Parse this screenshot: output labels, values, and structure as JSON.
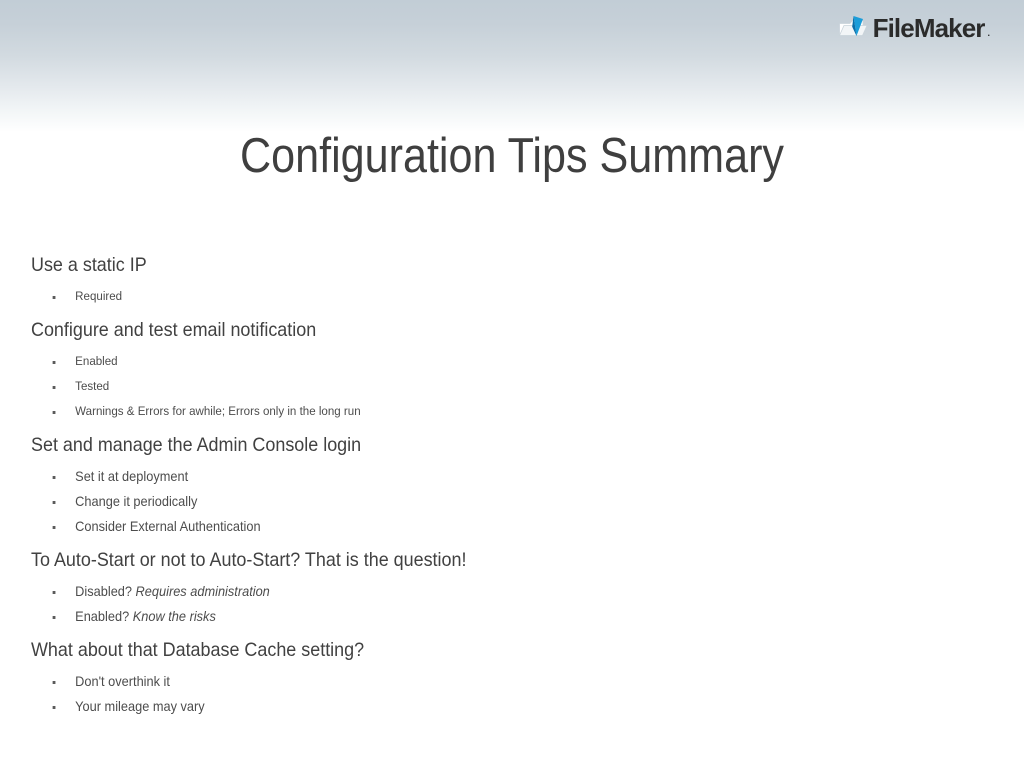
{
  "slide": {
    "title": "Configuration Tips Summary",
    "background_top_color": "#c2cdd6",
    "background_bottom_color": "#ffffff",
    "title_color": "#3f3f3f",
    "body_text_color": "#4c4c4c"
  },
  "brand": {
    "name": "FileMaker",
    "trademark": ".",
    "mark_icon": "filemaker-folder-icon",
    "mark_color": "#1b9dd9",
    "mark_color_dark": "#0a6ea8",
    "word_color": "#2b2b2b"
  },
  "sections": [
    {
      "heading": "Use a static IP",
      "bullets": [
        {
          "text": "Required",
          "emphasis": ""
        }
      ]
    },
    {
      "heading": "Configure and test email notification",
      "bullets": [
        {
          "text": "Enabled",
          "emphasis": ""
        },
        {
          "text": "Tested",
          "emphasis": ""
        },
        {
          "text": "Warnings & Errors for awhile; Errors only in the long run",
          "emphasis": ""
        }
      ]
    },
    {
      "heading": "Set and manage the Admin Console login",
      "bullets": [
        {
          "text": "Set it at deployment",
          "emphasis": ""
        },
        {
          "text": "Change it periodically",
          "emphasis": ""
        },
        {
          "text": "Consider External Authentication",
          "emphasis": ""
        }
      ]
    },
    {
      "heading": "To Auto-Start or not to Auto-Start? That is the question!",
      "bullets": [
        {
          "text": "Disabled? ",
          "emphasis": "Requires administration"
        },
        {
          "text": "Enabled? ",
          "emphasis": "Know the risks"
        }
      ]
    },
    {
      "heading": "What about that Database Cache setting?",
      "bullets": [
        {
          "text": "Don't overthink it",
          "emphasis": ""
        },
        {
          "text": "Your mileage may vary",
          "emphasis": ""
        }
      ]
    }
  ]
}
